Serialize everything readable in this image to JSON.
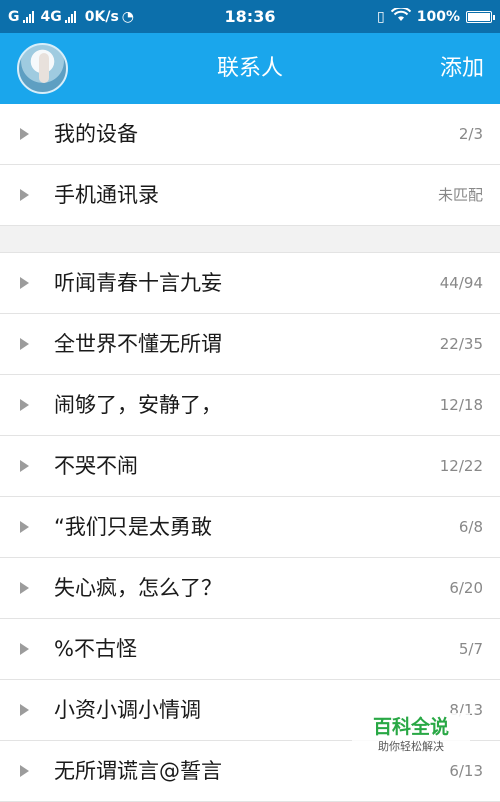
{
  "status_bar": {
    "carrier1": "G",
    "carrier2": "4G",
    "speed": "0K/s",
    "time": "18:36",
    "battery": "100%",
    "battery_level": 1.0
  },
  "header": {
    "title": "联系人",
    "add_label": "添加"
  },
  "groups_top": [
    {
      "name": "我的设备",
      "count": "2/3"
    },
    {
      "name": "手机通讯录",
      "count": "未匹配"
    }
  ],
  "groups": [
    {
      "name": "听闻青春十言九妄",
      "count": "44/94"
    },
    {
      "name": "全世界不懂无所谓",
      "count": "22/35"
    },
    {
      "name": "闹够了，安静了，",
      "count": "12/18"
    },
    {
      "name": "不哭不闹",
      "count": "12/22"
    },
    {
      "name": "“我们只是太勇敢",
      "count": "6/8"
    },
    {
      "name": "失心疯，怎么了？",
      "count": "6/20"
    },
    {
      "name": "%不古怪",
      "count": "5/7"
    },
    {
      "name": "小资小调小情调",
      "count": "8/13"
    },
    {
      "name": "无所谓谎言@誓言",
      "count": "6/13"
    }
  ],
  "watermark": {
    "main": "百科全说",
    "sub": "助你轻松解决"
  },
  "colors": {
    "status_bar": "#0c6fab",
    "header": "#1aa6ec",
    "watermark_green": "#29a845"
  }
}
